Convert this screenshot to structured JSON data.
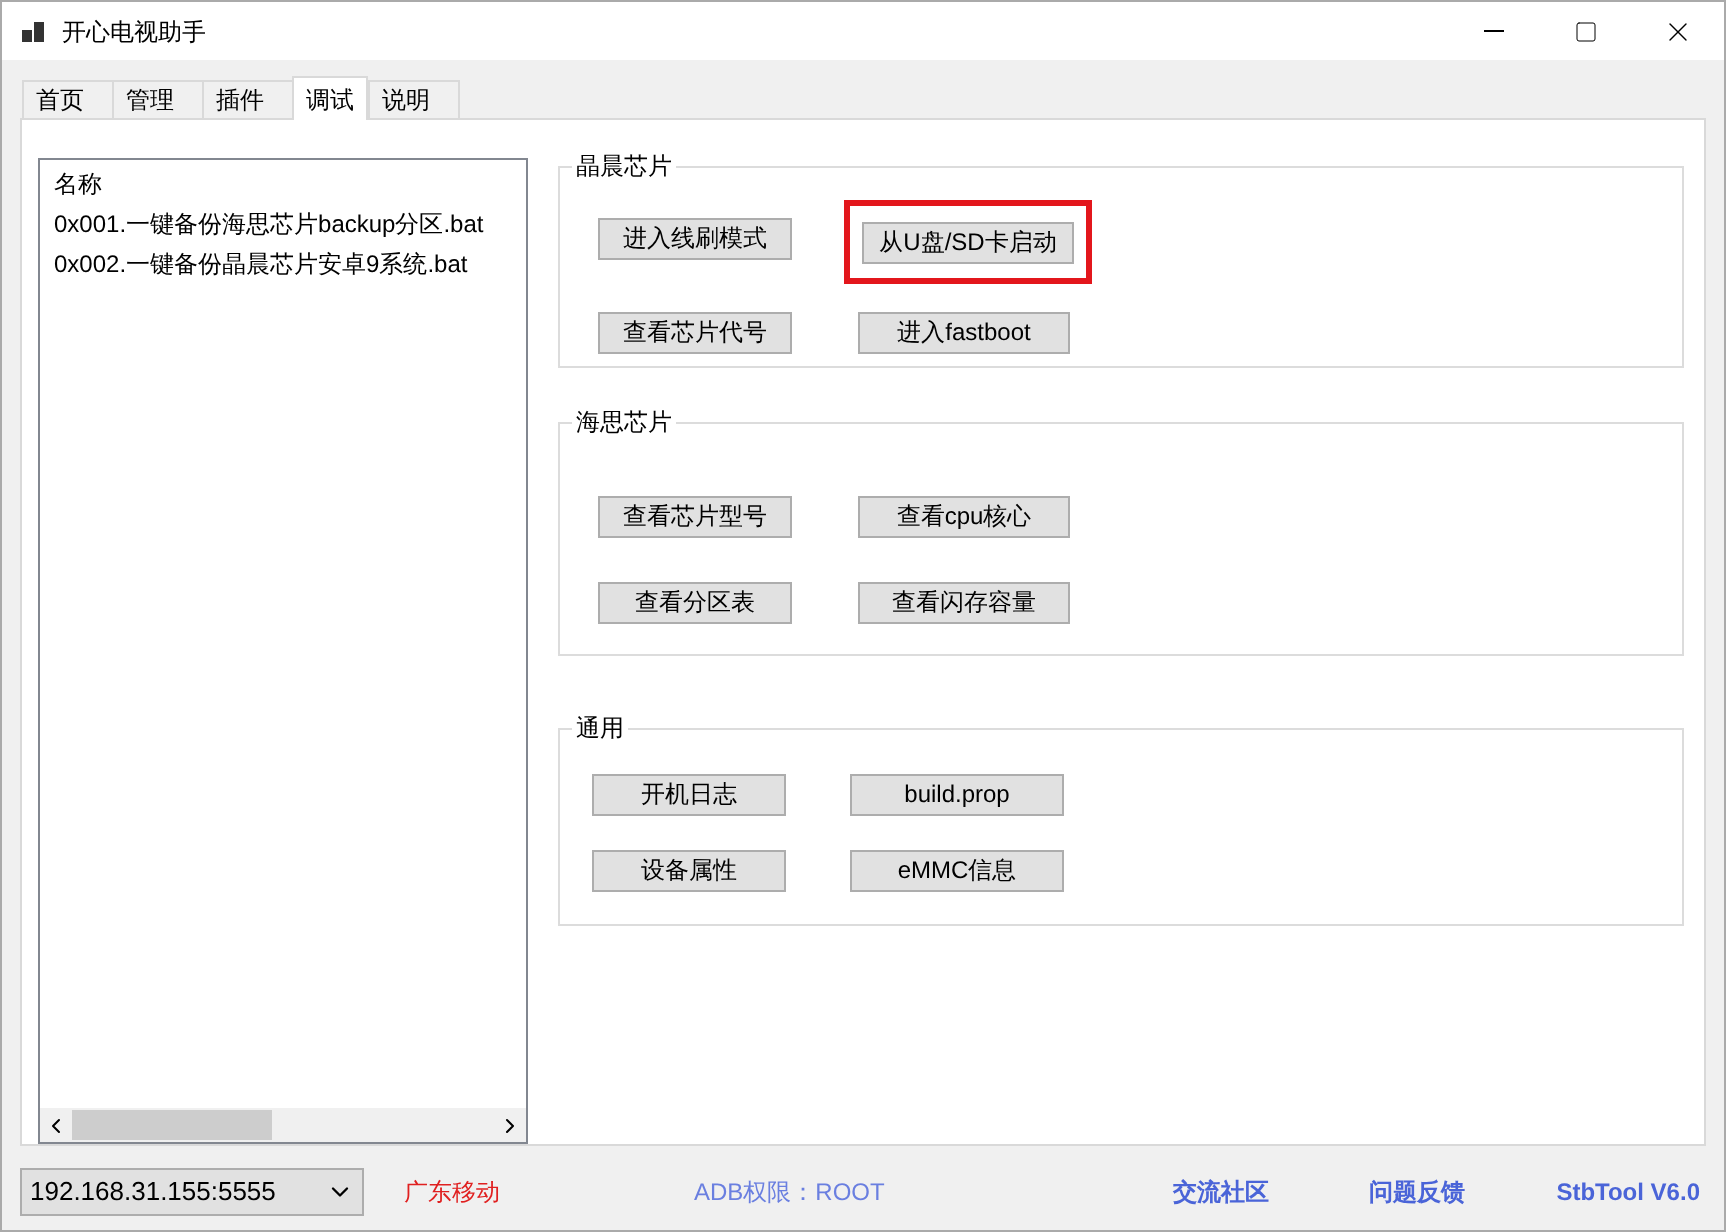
{
  "window": {
    "title": "开心电视助手"
  },
  "tabs": [
    {
      "label": "首页",
      "selected": false
    },
    {
      "label": "管理",
      "selected": false
    },
    {
      "label": "插件",
      "selected": false
    },
    {
      "label": "调试",
      "selected": true
    },
    {
      "label": "说明",
      "selected": false
    }
  ],
  "file_list": {
    "header": "名称",
    "items": [
      "0x001.一键备份海思芯片backup分区.bat",
      "0x002.一键备份晶晨芯片安卓9系统.bat"
    ]
  },
  "groups": [
    {
      "title": "晶晨芯片",
      "buttons": [
        {
          "label": "进入线刷模式",
          "highlighted": false
        },
        {
          "label": "从U盘/SD卡启动",
          "highlighted": true
        },
        {
          "label": "查看芯片代号",
          "highlighted": false
        },
        {
          "label": "进入fastboot",
          "highlighted": false
        }
      ]
    },
    {
      "title": "海思芯片",
      "buttons": [
        {
          "label": "查看芯片型号",
          "highlighted": false
        },
        {
          "label": "查看cpu核心",
          "highlighted": false
        },
        {
          "label": "查看分区表",
          "highlighted": false
        },
        {
          "label": "查看闪存容量",
          "highlighted": false
        }
      ]
    },
    {
      "title": "通用",
      "buttons": [
        {
          "label": "开机日志",
          "highlighted": false
        },
        {
          "label": "build.prop",
          "highlighted": false
        },
        {
          "label": "设备属性",
          "highlighted": false
        },
        {
          "label": "eMMC信息",
          "highlighted": false
        }
      ]
    }
  ],
  "status_bar": {
    "device": "192.168.31.155:5555",
    "carrier": "广东移动",
    "adb": "ADB权限：ROOT",
    "community_link": "交流社区",
    "feedback_link": "问题反馈",
    "version": "StbTool V6.0"
  }
}
